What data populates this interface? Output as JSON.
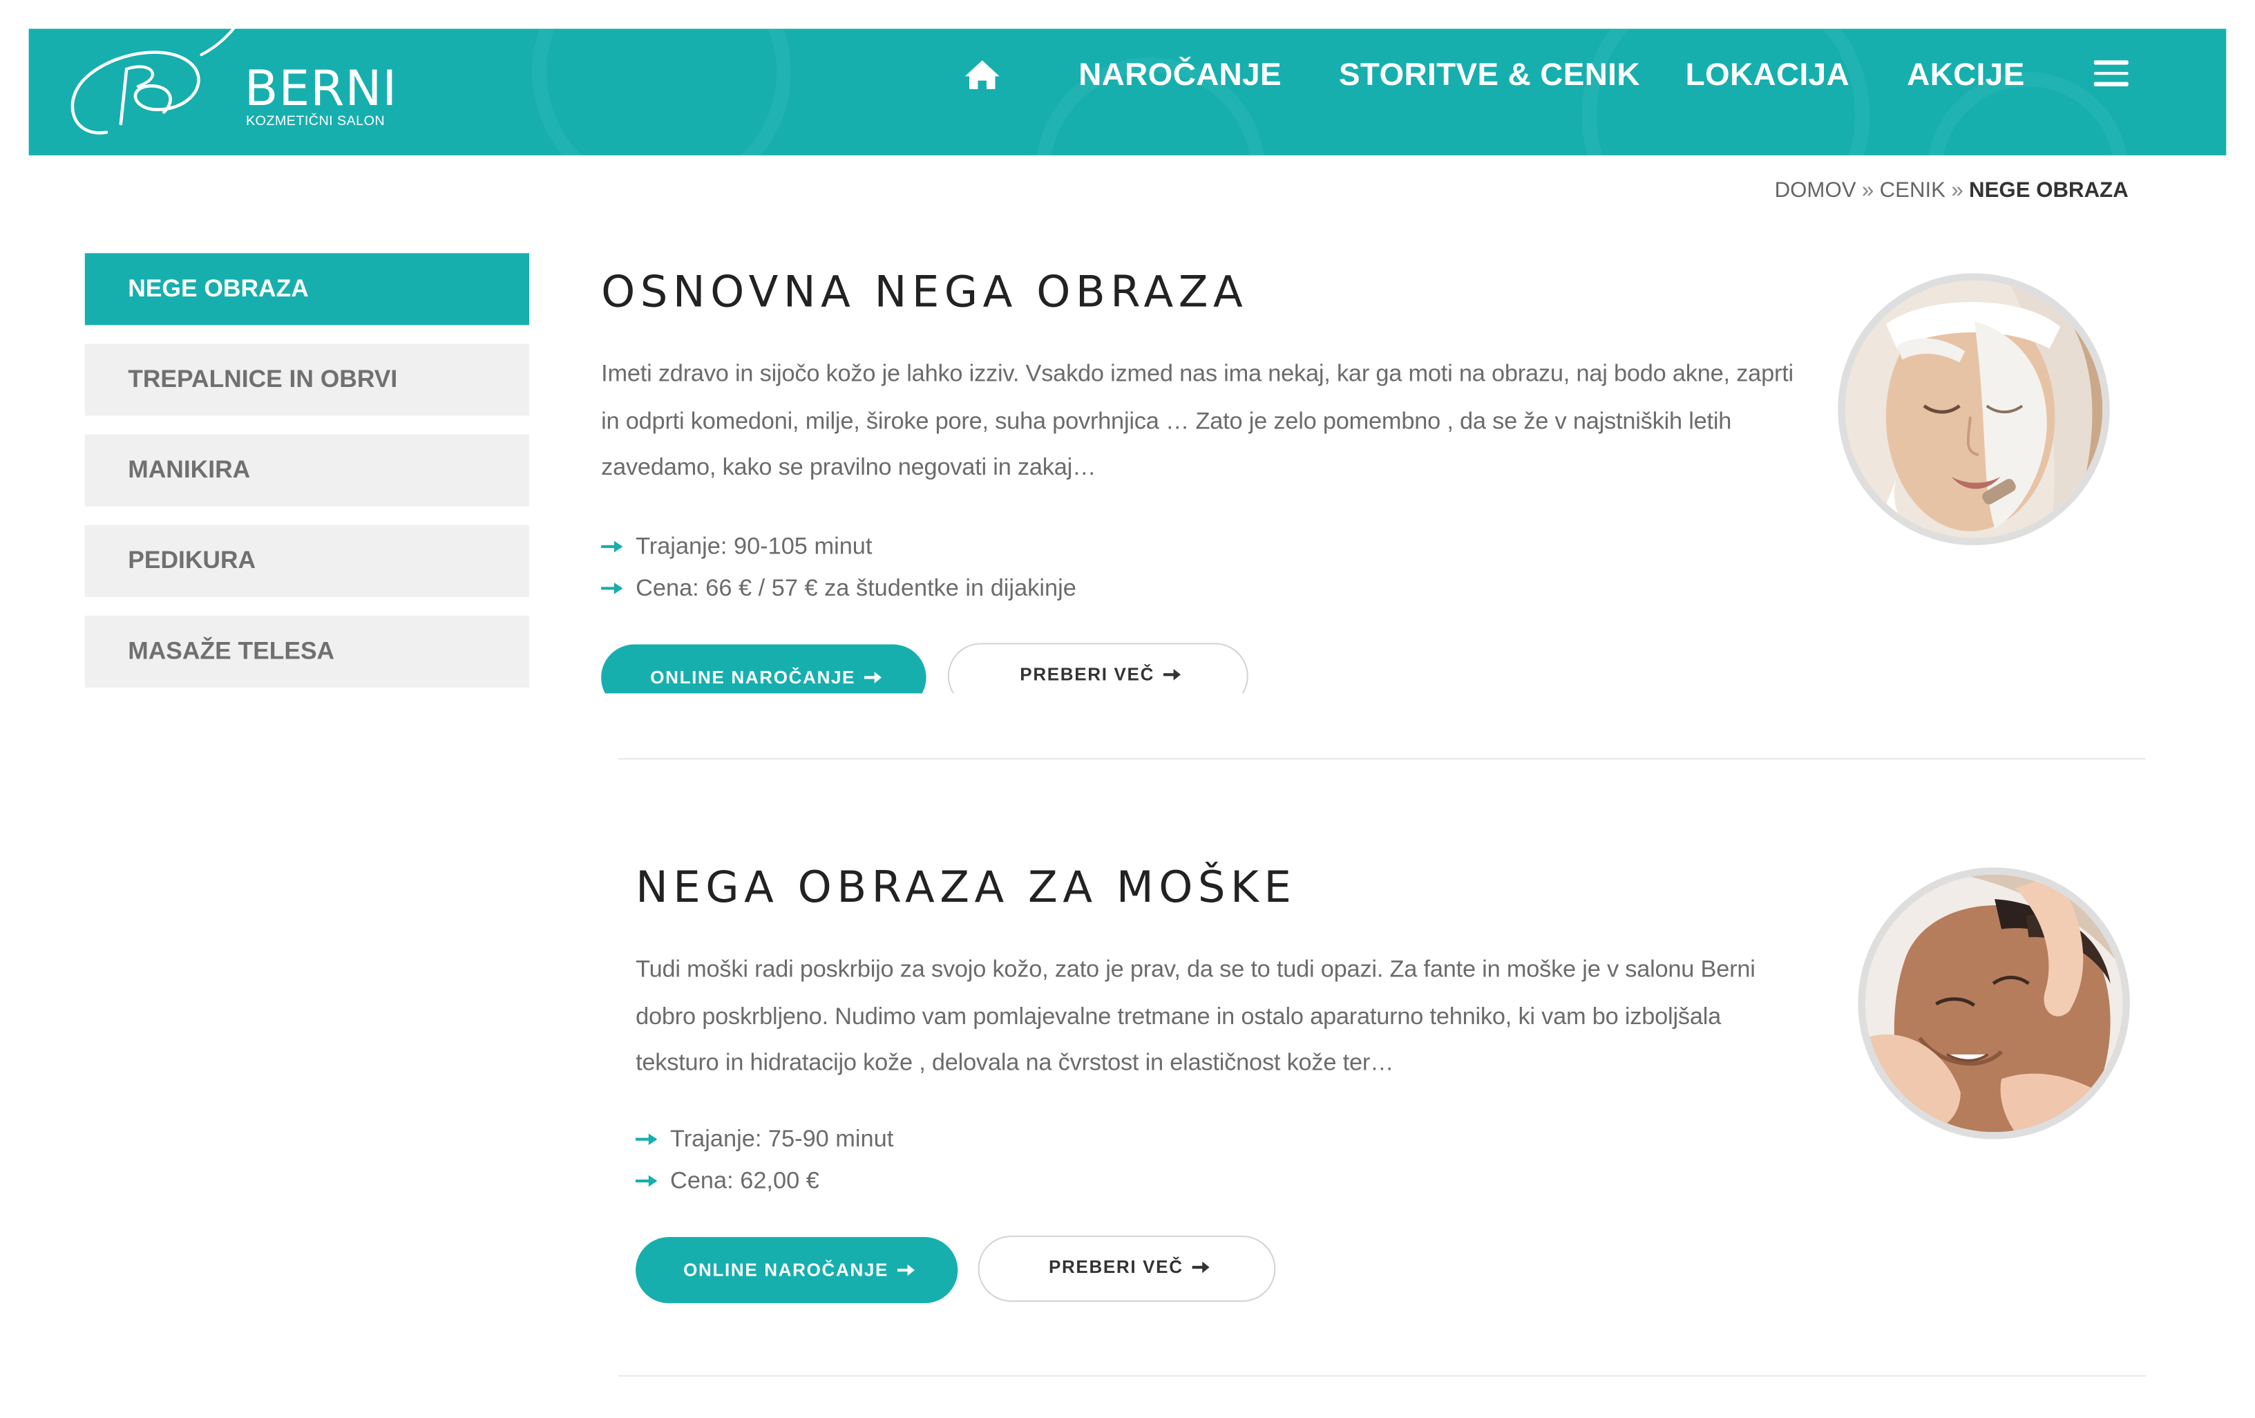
{
  "brand": {
    "name": "BERNI",
    "subtitle": "KOZMETIČNI SALON",
    "accent": "#16afae"
  },
  "nav": {
    "home_icon": "home-icon",
    "items": [
      "NAROČANJE",
      "STORITVE & CENIK",
      "LOKACIJA",
      "AKCIJE"
    ],
    "menu_icon": "hamburger-menu-icon"
  },
  "breadcrumb": {
    "home": "DOMOV",
    "separator": "»",
    "parent": "CENIK",
    "current": "NEGE OBRAZA"
  },
  "sidebar": {
    "active_index": 0,
    "items": [
      "NEGE OBRAZA",
      "TREPALNICE IN OBRVI",
      "MANIKIRA",
      "PEDIKURA",
      "MASAŽE TELESA"
    ]
  },
  "services": [
    {
      "title": "OSNOVNA NEGA OBRAZA",
      "description": "Imeti zdravo in sijočo kožo je lahko izziv. Vsakdo izmed nas ima nekaj, kar ga moti na obrazu, naj bodo akne, zaprti in odprti komedoni, milje, široke pore, suha povrhnjica … Zato je zelo pomembno , da se že v najstniških letih zavedamo, kako se pravilno negovati in zakaj…",
      "duration": "Trajanje: 90-105 minut",
      "price": "Cena: 66 € / 57 € za študentke in dijakinje",
      "book_label": "ONLINE NAROČANJE",
      "more_label": "PREBERI VEČ"
    },
    {
      "title": "NEGA OBRAZA ZA MOŠKE",
      "description": "Tudi moški radi poskrbijo za svojo kožo, zato je prav, da se to tudi opazi. Za fante in moške je v salonu Berni dobro poskrbljeno. Nudimo vam pomlajevalne tretmane in ostalo aparaturno tehniko, ki vam bo izboljšala teksturo in hidratacijo kože , delovala na čvrstost in elastičnost kože ter…",
      "duration": "Trajanje: 75-90 minut",
      "price": "Cena: 62,00 €",
      "book_label": "ONLINE NAROČANJE",
      "more_label": "PREBERI VEČ"
    }
  ]
}
